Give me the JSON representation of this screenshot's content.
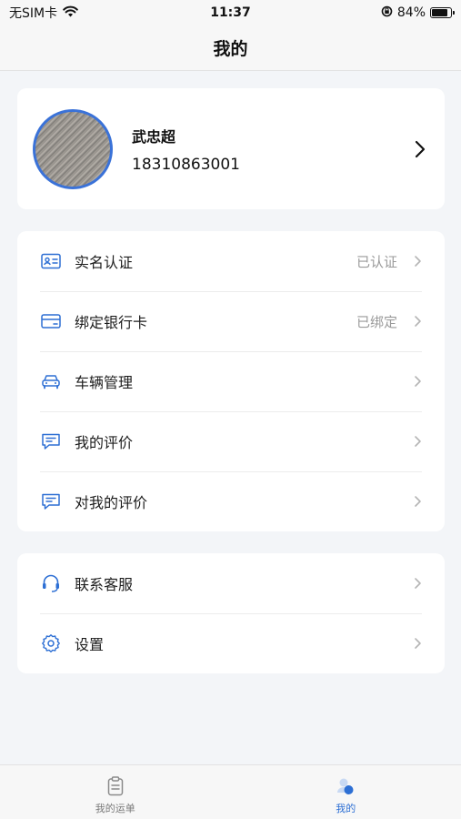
{
  "status_bar": {
    "carrier": "无SIM卡",
    "time": "11:37",
    "battery": "84%",
    "battery_level": 0.84
  },
  "header": {
    "title": "我的"
  },
  "profile": {
    "name": "武忠超",
    "phone": "18310863001"
  },
  "menu_group_1": [
    {
      "label": "实名认证",
      "status": "已认证",
      "icon": "id-card-icon"
    },
    {
      "label": "绑定银行卡",
      "status": "已绑定",
      "icon": "bank-card-icon"
    },
    {
      "label": "车辆管理",
      "status": "",
      "icon": "car-icon"
    },
    {
      "label": "我的评价",
      "status": "",
      "icon": "chat-icon"
    },
    {
      "label": "对我的评价",
      "status": "",
      "icon": "chat-icon"
    }
  ],
  "menu_group_2": [
    {
      "label": "联系客服",
      "icon": "headset-icon"
    },
    {
      "label": "设置",
      "icon": "gear-icon"
    }
  ],
  "tab_bar": {
    "tabs": [
      {
        "label": "我的运单",
        "icon": "clipboard-icon",
        "active": false
      },
      {
        "label": "我的",
        "icon": "user-icon",
        "active": true
      }
    ],
    "active_color": "#2d6fd4",
    "inactive_color": "#7a7a7a"
  },
  "colors": {
    "accent": "#3a72d8",
    "icon_blue": "#2d6fd4"
  }
}
